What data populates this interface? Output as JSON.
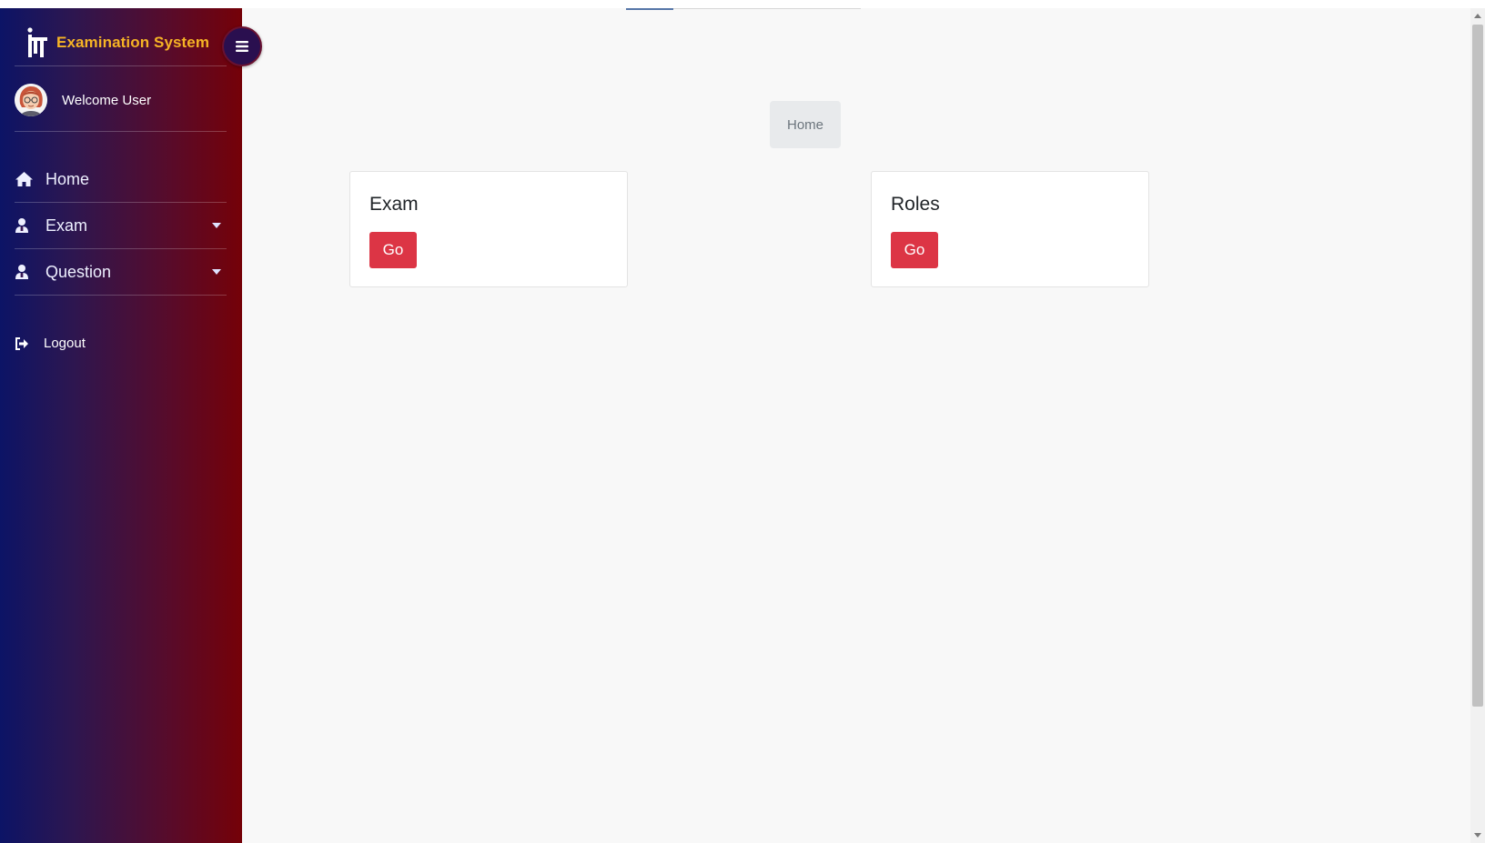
{
  "app": {
    "title": "Examination System",
    "colors": {
      "brand_title": "#f6b425",
      "primary_button": "#dc3545",
      "sidebar_gradient_start": "#0c1466",
      "sidebar_gradient_end": "#750108"
    }
  },
  "sidebar": {
    "welcome_text": "Welcome User",
    "toggle_icon": "hamburger-icon",
    "items": [
      {
        "label": "Home",
        "icon": "home-icon",
        "has_submenu": false
      },
      {
        "label": "Exam",
        "icon": "user-icon",
        "has_submenu": true
      },
      {
        "label": "Question",
        "icon": "user-icon",
        "has_submenu": true
      }
    ],
    "logout_label": "Logout",
    "logout_icon": "sign-out-icon"
  },
  "breadcrumb": {
    "current": "Home"
  },
  "cards": [
    {
      "title": "Exam",
      "button_label": "Go"
    },
    {
      "title": "Roles",
      "button_label": "Go"
    }
  ]
}
